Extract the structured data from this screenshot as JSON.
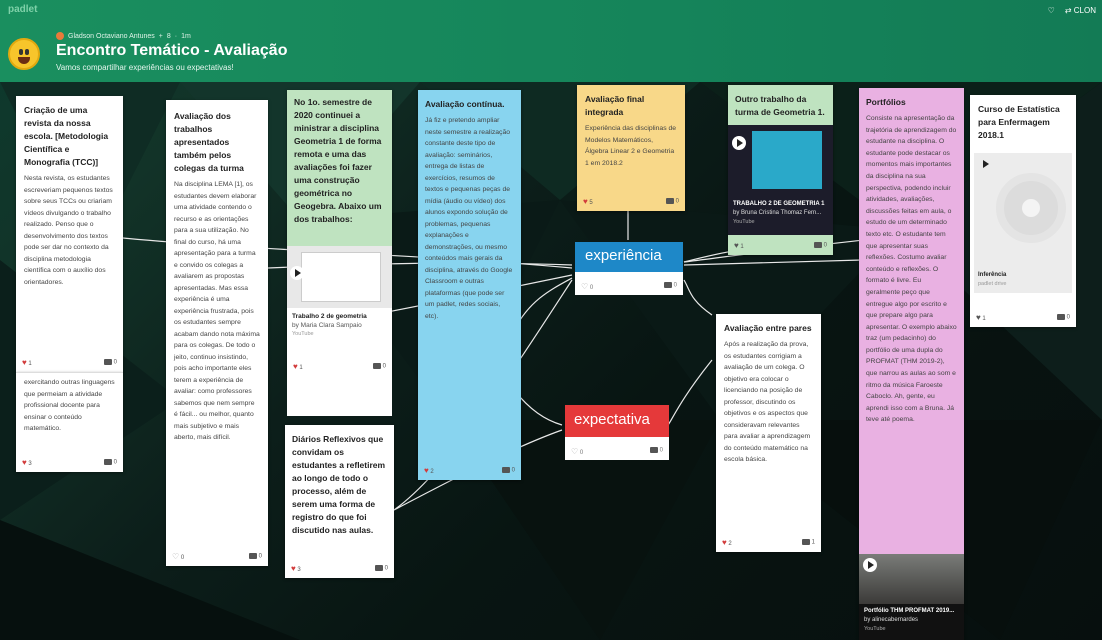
{
  "app": {
    "brand": "padlet",
    "heart_icon": "heart-icon",
    "remake_label": "CLON"
  },
  "header": {
    "author": "Gladson Octaviano Antunes",
    "count": "8",
    "time": "1m",
    "title": "Encontro Temático - Avaliação",
    "subtitle": "Vamos compartilhar experiências ou expectativas!"
  },
  "labels": {
    "experiencia": "experiência",
    "expectativa": "expectativa",
    "experiencia_likes": "0",
    "experiencia_comments": "0",
    "expectativa_likes": "0",
    "expectativa_comments": "0"
  },
  "cards": {
    "revista": {
      "title": "Criação de uma revista da nossa escola. [Metodologia Científica e Monografia (TCC)]",
      "body": "Nesta revista, os estudantes escreveriam pequenos textos sobre seus TCCs ou criariam vídeos divulgando o trabalho realizado. Penso que o desenvolvimento dos textos pode ser dar no contexto da disciplina metodologia científica com o auxílio dos orientadores.",
      "likes": "1",
      "comments": "0"
    },
    "outras": {
      "body": "exercitando outras linguagens que permeiam a atividade profissional docente para ensinar o conteúdo matemático.",
      "likes": "3",
      "comments": "0"
    },
    "trabalhos": {
      "title": "Avaliação dos trabalhos apresentados também pelos colegas da turma",
      "body": "Na disciplina LEMA [1], os estudantes devem elaborar uma atividade contendo o recurso e as orientações para a sua utilização. No final do curso, há uma apresentação para a turma e convido os colegas a avaliarem as propostas apresentadas. Mas essa experiência é uma experiência frustrada, pois os estudantes sempre acabam dando nota máxima para os colegas. De todo o jeito, continuo insistindo, pois acho importante eles terem a experiência de avaliar: como professores sabemos que nem sempre é fácil... ou melhor, quanto mais subjetivo e mais aberto, mais difícil.",
      "likes": "0",
      "comments": "0"
    },
    "semestre": {
      "title": "No 1o. semestre de 2020 continuei a ministrar a disciplina Geometria 1 de forma remota e uma das avaliações foi fazer uma construção geométrica no Geogebra. Abaixo um dos trabalhos:",
      "video_title": "Trabalho 2 de geometria",
      "video_author": "by Maria Clara Sampaio",
      "video_source": "YouTube",
      "likes": "1",
      "comments": "0"
    },
    "diarios": {
      "title": "Diários Reflexivos que convidam os estudantes a refletirem ao longo de todo o processo, além de serem uma forma de registro do que foi discutido nas aulas.",
      "likes": "3",
      "comments": "0"
    },
    "continua": {
      "title": "Avaliação contínua.",
      "body": "Já fiz e pretendo ampliar neste semestre a realização constante deste tipo de avaliação: seminários, entrega de listas de exercícios, resumos de textos e pequenas peças de mídia (áudio ou vídeo) dos alunos expondo solução de problemas, pequenas explanações e demonstrações, ou mesmo conteúdos mais gerais da disciplina, através do Google Classroom e outras plataformas (que pode ser um padlet, redes sociais, etc).",
      "likes": "2",
      "comments": "0"
    },
    "final": {
      "title": "Avaliação final integrada",
      "body": "Experiência das disciplinas de Modelos Matemáticos, Álgebra Linear 2 e Geometria 1 em 2018.2",
      "likes": "5",
      "comments": "0"
    },
    "outro": {
      "title": "Outro trabalho da turma de Geometria 1.",
      "video_title": "TRABALHO 2 DE GEOMETRIA 1",
      "video_author": "by Bruna Cristina Thomaz Fern...",
      "video_source": "YouTube",
      "likes": "1",
      "comments": "0"
    },
    "pares": {
      "title": "Avaliação entre pares",
      "body": "Após a realização da prova, os estudantes corrigiam a avaliação de um colega. O objetivo era colocar o licenciando na posição de professor, discutindo os objetivos e os aspectos que consideravam relevantes para avaliar a aprendizagem do conteúdo matemático na escola básica.",
      "likes": "2",
      "comments": "1"
    },
    "portfolios": {
      "title": "Portfólios",
      "body": "Consiste na apresentação da trajetória de aprendizagem do estudante na disciplina. O estudante pode destacar os momentos mais importantes da disciplina na sua perspectiva, podendo incluir atividades, avaliações, discussões feitas em aula, o estudo de um determinado texto etc. O estudante tem que apresentar suas reflexões. Costumo avaliar conteúdo e reflexões. O formato é livre. Eu geralmente peço que entregue algo por escrito e que prepare algo para apresentar. O exemplo abaixo traz (um pedacinho) do portfólio de uma dupla do PROFMAT (THM 2019-2), que narrou as aulas ao som e ritmo da música Faroeste Caboclo. Ah, gente, eu aprendi isso com a Bruna. Já teve até poema.",
      "video_title": "Portfólio THM PROFMAT 2019...",
      "video_author": "by alinecabernardes",
      "video_source": "YouTube"
    },
    "estatistica": {
      "title": "Curso de Estatística para Enfermagem 2018.1",
      "att_title": "Inferência",
      "att_source": "padlet drive",
      "likes": "1",
      "comments": "0"
    }
  }
}
